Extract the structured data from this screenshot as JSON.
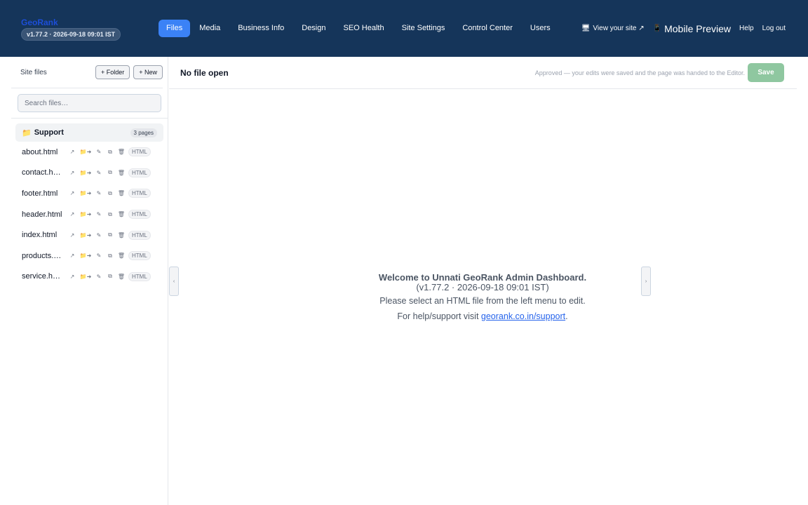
{
  "brand": {
    "name": "GeoRank",
    "version": "v1.77.2 · 2026-09-18 09:01 IST"
  },
  "nav": [
    {
      "label": "Files",
      "active": true
    },
    {
      "label": "Media"
    },
    {
      "label": "Business Info"
    },
    {
      "label": "Design"
    },
    {
      "label": "SEO Health"
    },
    {
      "label": "Site Settings"
    },
    {
      "label": "Control Center"
    },
    {
      "label": "Users"
    }
  ],
  "header_links": {
    "view_site": "View your site ↗",
    "mobile_preview": "Mobile Preview",
    "help": "Help",
    "logout": "Log out"
  },
  "sidebar": {
    "title": "Site files",
    "add_folder": "+ Folder",
    "add_new": "+ New",
    "search_placeholder": "Search files…",
    "folder": {
      "name": "Support",
      "count": "3 pages"
    },
    "files": [
      {
        "name": "about.html",
        "type": "HTML"
      },
      {
        "name": "contact.html",
        "type": "HTML"
      },
      {
        "name": "footer.html",
        "type": "HTML"
      },
      {
        "name": "header.html",
        "type": "HTML"
      },
      {
        "name": "index.html",
        "type": "HTML"
      },
      {
        "name": "products.html",
        "type": "HTML"
      },
      {
        "name": "service.html",
        "type": "HTML"
      }
    ]
  },
  "editor": {
    "file_title": "No file open",
    "status": "Approved — your edits were saved and the page was handed to the Editor.",
    "save_label": "Save",
    "collapse_left": "‹",
    "collapse_right": "›"
  },
  "welcome": {
    "title": "Welcome to Unnati GeoRank Admin Dashboard.",
    "version": "(v1.77.2 · 2026-09-18 09:01 IST)",
    "instruction": "Please select an HTML file from the left menu to edit.",
    "help_prefix": "For help/support visit ",
    "help_link": "georank.co.in/support",
    "help_suffix": "."
  },
  "colors": {
    "topbar": "#15355a",
    "accent": "#3b82f6",
    "save": "#8fc7a0",
    "link": "#2563eb"
  }
}
